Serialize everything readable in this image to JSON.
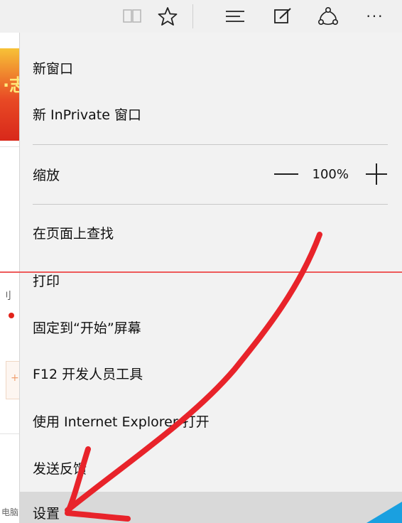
{
  "toolbar": {
    "buttons": [
      {
        "name": "reading-view-icon"
      },
      {
        "name": "favorite-star-icon"
      },
      {
        "name": "hub-icon"
      },
      {
        "name": "web-note-icon"
      },
      {
        "name": "share-icon"
      },
      {
        "name": "more-actions-icon",
        "glyph": "···"
      }
    ]
  },
  "page": {
    "banner_char": "·志",
    "edge_chars": [
      "刂",
      "电脑"
    ]
  },
  "menu": {
    "new_window": "新窗口",
    "new_inprivate": "新 InPrivate 窗口",
    "zoom_label": "缩放",
    "zoom_value": "100%",
    "find_on_page": "在页面上查找",
    "print": "打印",
    "pin_to_start": "固定到“开始”屏幕",
    "f12_tools": "F12 开发人员工具",
    "open_with_ie": "使用 Internet Explorer 打开",
    "send_feedback": "发送反馈",
    "settings": "设置"
  },
  "colors": {
    "annotation_red": "#e8232a",
    "menu_bg": "#f2f2f2",
    "active_bg": "#d9d9d9"
  }
}
